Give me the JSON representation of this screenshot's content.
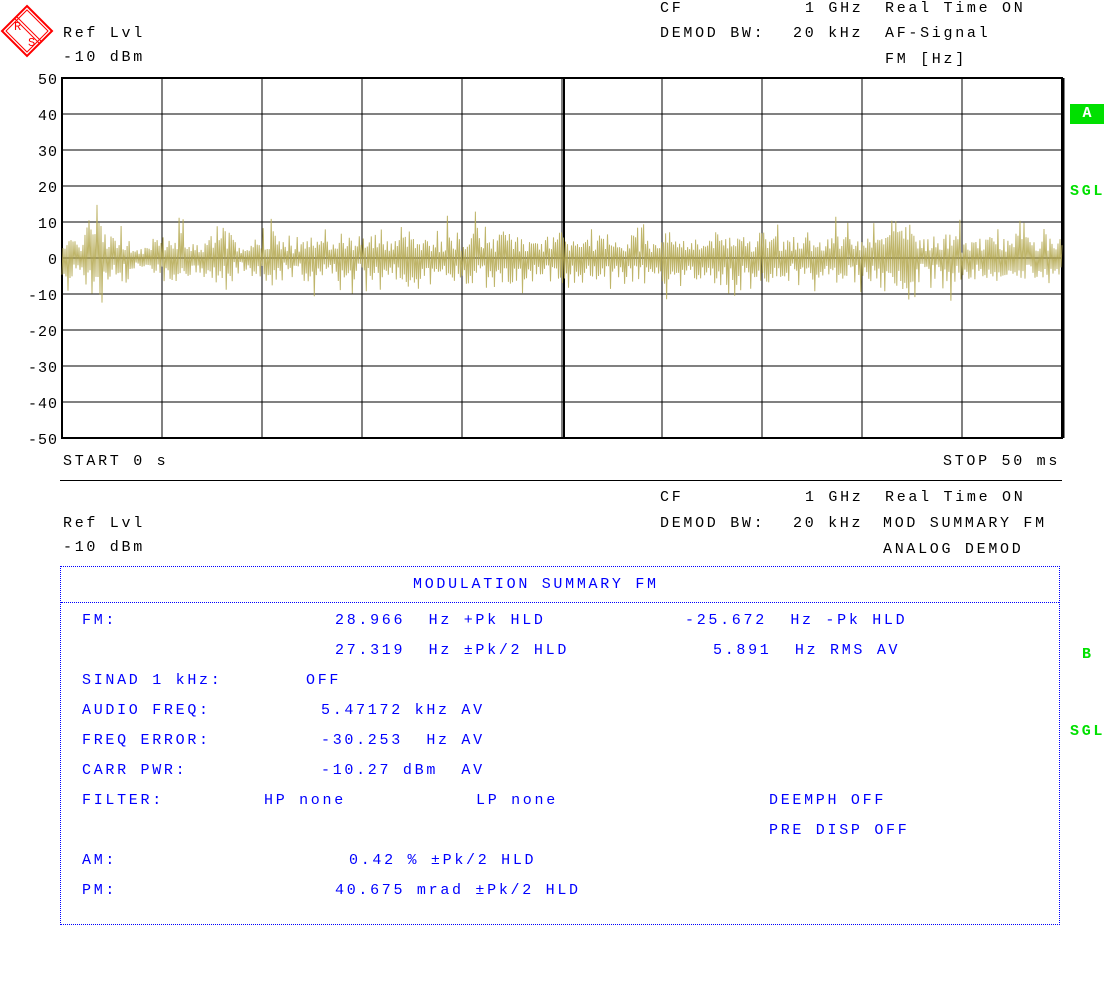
{
  "logo_text": "R&S",
  "screen_a": {
    "ref_lvl_label": "Ref Lvl",
    "ref_lvl_value": "-10 dBm",
    "cf_label": "CF",
    "cf_value": "1 GHz",
    "demod_bw_label": "DEMOD BW:",
    "demod_bw_value": "20 kHz",
    "realtime": "Real Time ON",
    "mode": "AF-Signal",
    "unit": "FM [Hz]",
    "trace_badge": "A",
    "sweep_mode": "SGL",
    "start": "START 0 s",
    "stop": "STOP 50 ms"
  },
  "chart_data": {
    "type": "line",
    "xlabel": "",
    "ylabel": "",
    "xlim": [
      0,
      50
    ],
    "x_unit": "ms",
    "ylim": [
      -50,
      50
    ],
    "yticks": [
      "50",
      "40",
      "30",
      "20",
      "10",
      "0",
      "-10",
      "-20",
      "-30",
      "-40",
      "-50"
    ],
    "grid": true,
    "trace_color": "#c8b400",
    "values": [
      12,
      -8,
      17,
      -18,
      14,
      -10,
      8,
      -6,
      5,
      -9,
      11,
      -12,
      9,
      -7,
      10,
      -13,
      12,
      -6,
      9,
      -10,
      13,
      -11,
      7,
      -8,
      11,
      -9,
      8,
      -12,
      10,
      -7,
      12,
      -9,
      9,
      -11,
      14,
      -10,
      10,
      -8,
      12,
      -9,
      13,
      -11,
      9,
      -13,
      12,
      -10,
      8,
      -7,
      11,
      -12,
      9,
      -8,
      10,
      -11,
      12,
      -9,
      11,
      -10,
      8,
      -12,
      13,
      -9,
      10,
      -8,
      12,
      -11,
      14,
      -9,
      9,
      -12,
      11,
      -10,
      8,
      -8,
      10,
      -9,
      12,
      -11,
      9,
      -10,
      11,
      -12,
      19,
      -22,
      13,
      -9,
      10,
      -11,
      12,
      -8,
      9,
      -10,
      11,
      -9,
      12,
      -10,
      8,
      -11,
      10,
      -9
    ]
  },
  "screen_b": {
    "ref_lvl_label": "Ref Lvl",
    "ref_lvl_value": "-10 dBm",
    "cf_label": "CF",
    "cf_value": "1 GHz",
    "demod_bw_label": "DEMOD BW:",
    "demod_bw_value": "20 kHz",
    "realtime": "Real Time ON",
    "mode": "MOD SUMMARY FM",
    "submode": "ANALOG DEMOD",
    "trace_badge": "B",
    "sweep_mode": "SGL"
  },
  "summary": {
    "title": "MODULATION SUMMARY FM",
    "fm_label": "FM:",
    "fm_pos_pk": "28.966  Hz +Pk HLD",
    "fm_neg_pk": "-25.672  Hz -Pk HLD",
    "fm_pk2": "27.319  Hz ±Pk/2 HLD",
    "fm_rms": "5.891  Hz RMS AV",
    "sinad_label": "SINAD 1 kHz:",
    "sinad_value": "OFF",
    "audio_freq_label": "AUDIO FREQ:",
    "audio_freq_value": "5.47172 kHz AV",
    "freq_error_label": "FREQ ERROR:",
    "freq_error_value": "-30.253  Hz AV",
    "carr_pwr_label": "CARR PWR:",
    "carr_pwr_value": "-10.27 dBm  AV",
    "filter_label": "FILTER:",
    "hp": "HP none",
    "lp": "LP none",
    "deemph": "DEEMPH OFF",
    "pre_disp": "PRE DISP OFF",
    "am_label": "AM:",
    "am_value": "0.42 % ±Pk/2 HLD",
    "pm_label": "PM:",
    "pm_value": "40.675 mrad ±Pk/2 HLD"
  }
}
